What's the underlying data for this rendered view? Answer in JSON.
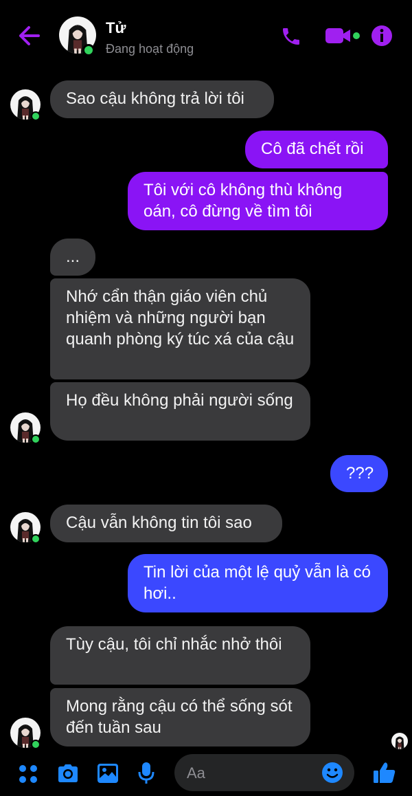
{
  "header": {
    "contact_name": "Tử",
    "status": "Đang hoạt động",
    "accent_color": "#a020f0"
  },
  "messages": [
    {
      "side": "in",
      "text": "Sao cậu không trả lời tôi"
    },
    {
      "side": "out",
      "text": "Cô đã chết rồi"
    },
    {
      "side": "out",
      "text": "Tôi với cô không thù không oán, cô đừng về tìm tôi"
    },
    {
      "side": "in",
      "text": "..."
    },
    {
      "side": "in",
      "text": "Nhớ cẩn thận giáo viên chủ nhiệm và những người bạn quanh phòng ký túc xá của cậu"
    },
    {
      "side": "in",
      "text": "Họ đều không phải người sống"
    },
    {
      "side": "out",
      "text": "???"
    },
    {
      "side": "in",
      "text": "Cậu vẫn không tin tôi sao"
    },
    {
      "side": "out",
      "text": "Tin lời của một lệ quỷ vẫn là có hơi.."
    },
    {
      "side": "in",
      "text": "Tùy cậu, tôi chỉ nhắc nhở thôi"
    },
    {
      "side": "in",
      "text": "Mong rằng cậu có thể sống sót đến tuần sau"
    }
  ],
  "composer": {
    "placeholder": "Aa",
    "icons": [
      "menu-dots-icon",
      "camera-icon",
      "gallery-icon",
      "microphone-icon",
      "emoji-icon",
      "thumbs-up-icon"
    ]
  },
  "colors": {
    "incoming_bubble": "#3a3a3c",
    "outgoing_purple": "#8a14f5",
    "outgoing_blue": "#3b48ff",
    "online": "#31d35c",
    "icon_blue": "#1e88ff"
  }
}
